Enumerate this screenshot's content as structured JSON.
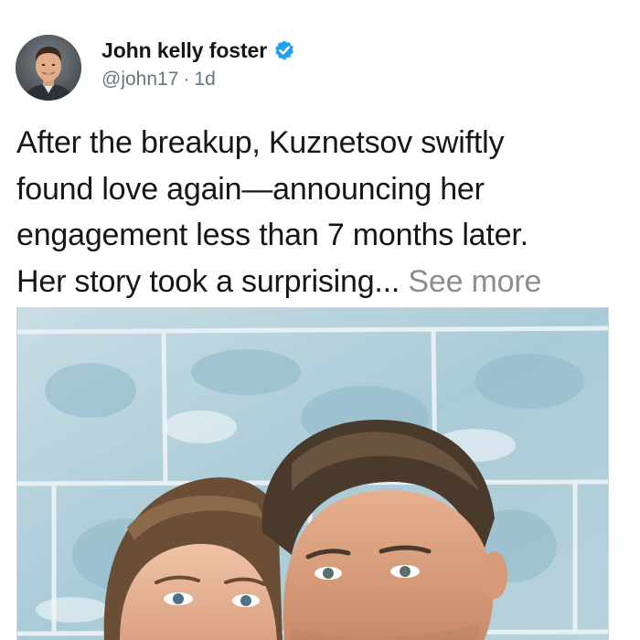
{
  "post": {
    "author": {
      "display_name": "John kelly foster",
      "handle": "@john17",
      "verified": true,
      "avatar_icon": "avatar-photo"
    },
    "meta": {
      "separator": "·",
      "time": "1d"
    },
    "body": {
      "lines": [
        "After the breakup, Kuznetsov swiftly",
        "found love again—announcing her",
        "engagement less than 7 months later.",
        "Her story took a surprising..."
      ],
      "see_more": "See more"
    },
    "media": {
      "type": "photo",
      "icon": "couple-photo"
    }
  },
  "colors": {
    "verified_badge": "#1da1f2",
    "secondary_text": "#657786",
    "see_more": "#8a8d91",
    "primary_text": "#14171a"
  }
}
